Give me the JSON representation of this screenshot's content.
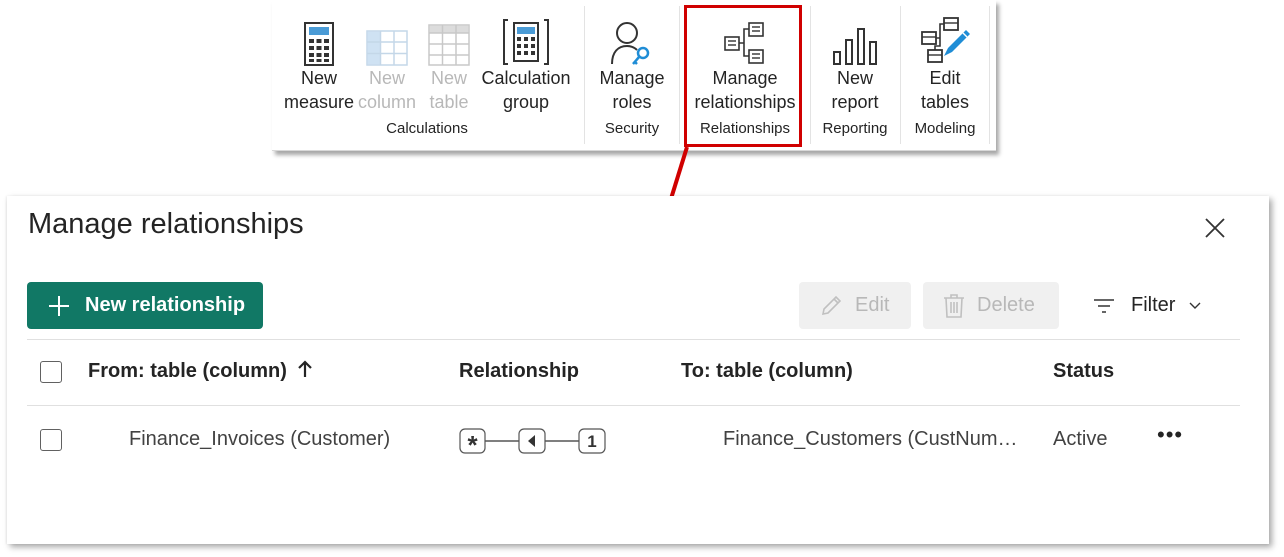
{
  "ribbon": {
    "buttons": [
      {
        "line1": "New",
        "line2": "measure"
      },
      {
        "line1": "New",
        "line2": "column"
      },
      {
        "line1": "New",
        "line2": "table"
      },
      {
        "line1": "Calculation",
        "line2": "group"
      },
      {
        "line1": "Manage",
        "line2": "roles"
      },
      {
        "line1": "Manage",
        "line2": "relationships"
      },
      {
        "line1": "New",
        "line2": "report"
      },
      {
        "line1": "Edit",
        "line2": "tables"
      }
    ],
    "groups": [
      "Calculations",
      "Security",
      "Relationships",
      "Reporting",
      "Modeling"
    ]
  },
  "dialog": {
    "title": "Manage relationships",
    "new_relationship_label": "New relationship",
    "edit_label": "Edit",
    "delete_label": "Delete",
    "filter_label": "Filter",
    "columns": {
      "from": "From: table (column)",
      "relationship": "Relationship",
      "to": "To: table (column)",
      "status": "Status"
    },
    "rows": [
      {
        "from": "Finance_Invoices (Customer)",
        "from_cardinality": "*",
        "to_cardinality": "1",
        "to": "Finance_Customers (CustNum…",
        "status": "Active"
      }
    ]
  },
  "colors": {
    "accent": "#117865",
    "highlight": "#d00000"
  }
}
